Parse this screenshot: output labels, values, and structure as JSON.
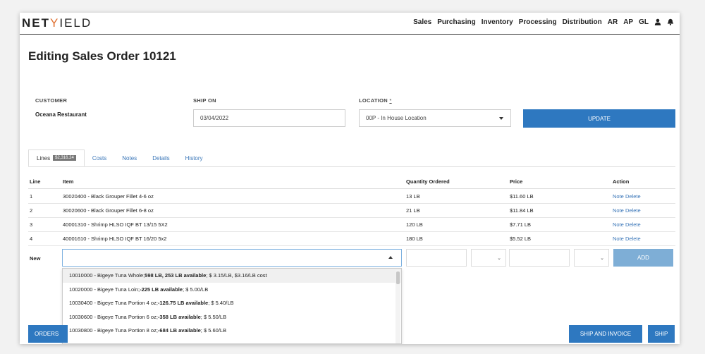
{
  "nav": {
    "logo_net": "NET",
    "logo_y": "Y",
    "logo_ield": "IELD",
    "links": [
      "Sales",
      "Purchasing",
      "Inventory",
      "Processing",
      "Distribution",
      "AR",
      "AP",
      "GL"
    ],
    "icons": [
      "user-icon",
      "bell-icon"
    ]
  },
  "page": {
    "title": "Editing Sales Order 10121"
  },
  "form": {
    "customer_label": "CUSTOMER",
    "customer_value": "Oceana Restaurant",
    "ship_on_label": "SHIP ON",
    "ship_on_value": "03/04/2022",
    "location_label": "LOCATION",
    "location_required": "*",
    "location_value": "00P - In House Location",
    "update_label": "UPDATE"
  },
  "tabs": [
    {
      "label": "Lines",
      "badge": "$2,316.24"
    },
    {
      "label": "Costs"
    },
    {
      "label": "Notes"
    },
    {
      "label": "Details"
    },
    {
      "label": "History"
    }
  ],
  "table": {
    "headers": [
      "Line",
      "Item",
      "Quantity Ordered",
      "Price",
      "Action"
    ],
    "rows": [
      {
        "line": "1",
        "item": "30020400 - Black Grouper Fillet 4-6 oz",
        "qty": "13 LB",
        "price": "$11.60 LB"
      },
      {
        "line": "2",
        "item": "30020600 - Black Grouper Fillet 6-8 oz",
        "qty": "21 LB",
        "price": "$11.84 LB"
      },
      {
        "line": "3",
        "item": "40001310 - Shrimp HLSO IQF BT 13/15 5X2",
        "qty": "120 LB",
        "price": "$7.71 LB"
      },
      {
        "line": "4",
        "item": "40001610 - Shrimp HLSO IQF BT 16/20 5x2",
        "qty": "180 LB",
        "price": "$5.52 LB"
      }
    ],
    "action_note": "Note",
    "action_delete": "Delete",
    "new_label": "New",
    "add_label": "ADD"
  },
  "dropdown": {
    "options": [
      {
        "prefix": "10010000 - Bigeye Tuna Whole; ",
        "bold": "598 LB, 253 LB available",
        "suffix": "; $ 3.15/LB, $3.16/LB cost"
      },
      {
        "prefix": "10020000 - Bigeye Tuna Loin; ",
        "bold": "-225 LB available",
        "suffix": "; $ 5.00/LB"
      },
      {
        "prefix": "10030400 - Bigeye Tuna Portion 4 oz; ",
        "bold": "-126.75 LB available",
        "suffix": "; $ 5.40/LB"
      },
      {
        "prefix": "10030600 - Bigeye Tuna Portion 6 oz; ",
        "bold": "-358 LB available",
        "suffix": "; $ 5.50/LB"
      },
      {
        "prefix": "10030800 - Bigeye Tuna Portion 8 oz; ",
        "bold": "-684 LB available",
        "suffix": "; $ 5.60/LB"
      }
    ]
  },
  "footer": {
    "orders_label": "ORDERS",
    "ship_invoice_label": "SHIP AND INVOICE",
    "ship_label": "SHIP"
  },
  "colors": {
    "primary": "#2e78c0",
    "add_button": "#7eaed6",
    "link": "#3a76b8"
  }
}
